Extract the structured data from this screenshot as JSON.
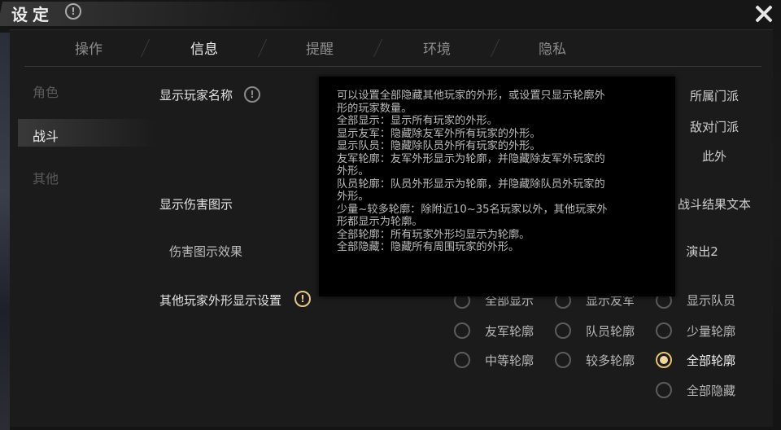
{
  "title": "设定",
  "tabs": [
    {
      "label": "操作"
    },
    {
      "label": "信息"
    },
    {
      "label": "提醒"
    },
    {
      "label": "环境"
    },
    {
      "label": "隐私"
    }
  ],
  "sidebar": {
    "items": [
      {
        "label": "角色"
      },
      {
        "label": "战斗"
      },
      {
        "label": "其他"
      }
    ]
  },
  "content": {
    "show_player_name": "显示玩家名称",
    "show_damage": "显示伤害图示",
    "damage_effect": "伤害图示效果",
    "other_appearance": "其他玩家外形显示设置",
    "right_options": [
      "所属门派",
      "敌对门派",
      "此外",
      "战斗结果文本",
      "演出2"
    ]
  },
  "appearance_options": [
    {
      "label": "全部显示",
      "checked": false
    },
    {
      "label": "显示友军",
      "checked": false
    },
    {
      "label": "显示队员",
      "checked": false
    },
    {
      "label": "友军轮廓",
      "checked": false
    },
    {
      "label": "队员轮廓",
      "checked": false
    },
    {
      "label": "少量轮廓",
      "checked": false
    },
    {
      "label": "中等轮廓",
      "checked": false
    },
    {
      "label": "较多轮廓",
      "checked": false
    },
    {
      "label": "全部轮廓",
      "checked": true
    },
    {
      "label": "全部隐藏",
      "checked": false
    }
  ],
  "tooltip": {
    "lines": [
      "可以设置全部隐藏其他玩家的外形，或设置只显示轮廓外",
      "形的玩家数量。",
      "全部显示：显示所有玩家的外形。",
      "显示友军：隐藏除友军外所有玩家的外形。",
      "显示队员：隐藏除队员外所有玩家的外形。",
      "友军轮廓：友军外形显示为轮廓，并隐藏除友军外玩家的",
      "外形。",
      "队员轮廓：队员外形显示为轮廓，并隐藏除队员外玩家的",
      "外形。",
      "少量~较多轮廓：除附近10~35名玩家以外，其他玩家外",
      "形都显示为轮廓。",
      "全部轮廓：所有玩家外形均显示为轮廓。",
      "全部隐藏：隐藏所有周围玩家的外形。"
    ]
  },
  "colors": {
    "accent": "#e8c070",
    "panel": "#1b1b1b",
    "tooltip_bg": "#000000"
  }
}
